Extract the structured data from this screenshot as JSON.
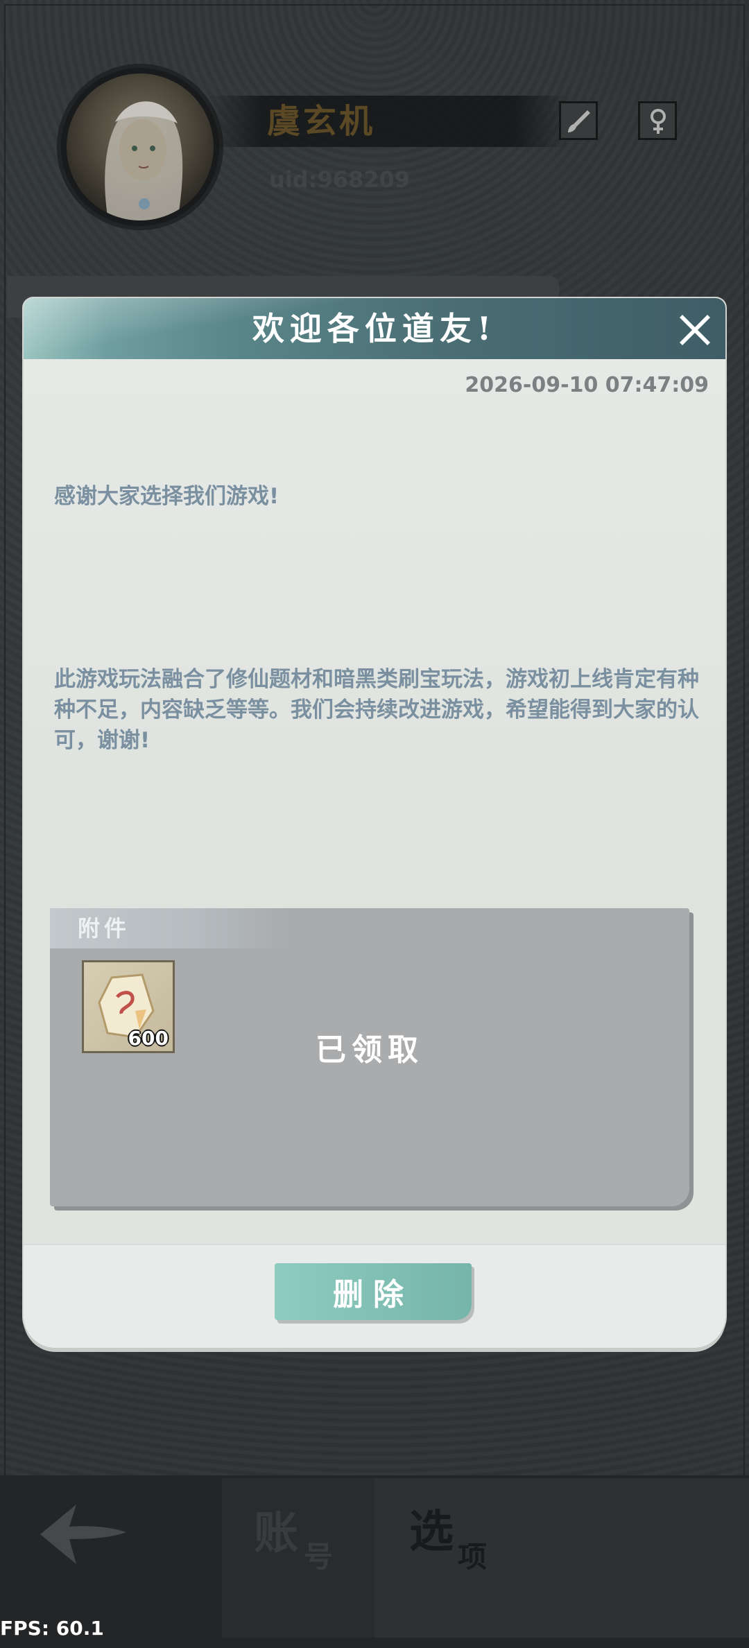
{
  "profile": {
    "name": "虞玄机",
    "uid": "uid:968209"
  },
  "dialog": {
    "title": "欢迎各位道友!",
    "date": "2026-09-10 07:47:09",
    "message": [
      "感谢大家选择我们游戏!",
      "此游戏玩法融合了修仙题材和暗黑类刷宝玩法，游戏初上线肯定有种种不足，内容缺乏等等。我们会持续改进游戏，希望能得到大家的认可，谢谢!"
    ],
    "attachment_label": "附件",
    "attachment_item": {
      "icon": "spirit-stone-icon",
      "count": "600"
    },
    "claimed_text": "已领取",
    "delete_label": "删除"
  },
  "tabs": {
    "account_big": "账",
    "account_small": "号",
    "options_big": "选",
    "options_small": "项"
  },
  "fps": "FPS: 60.1",
  "colors": {
    "header_teal": "#5a8689",
    "button_teal": "#8ecbc1",
    "message_text": "#7a90a0",
    "name_gold": "#6e5a2c"
  }
}
